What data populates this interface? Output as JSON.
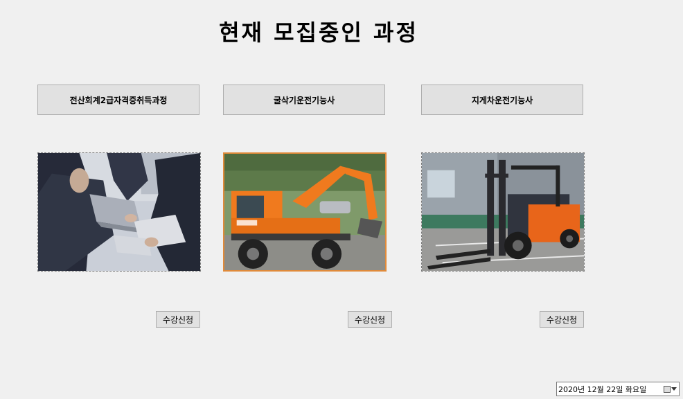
{
  "title": "현재 모집중인 과정",
  "courses": [
    {
      "label": "전산회계2급자격증취득과정",
      "image_icon": "office-meeting-photo",
      "apply_label": "수강신청"
    },
    {
      "label": "굴삭기운전기능사",
      "image_icon": "excavator-photo",
      "apply_label": "수강신청"
    },
    {
      "label": "지게차운전기능사",
      "image_icon": "forklift-photo",
      "apply_label": "수강신청"
    }
  ],
  "datepicker": {
    "value": "2020년 12월 22일 화요일"
  },
  "colors": {
    "background": "#f0f0f0",
    "button_face": "#e1e1e1",
    "button_border": "#adadad",
    "excavator_orange": "#f07a1e",
    "forklift_orange": "#e8651a"
  }
}
